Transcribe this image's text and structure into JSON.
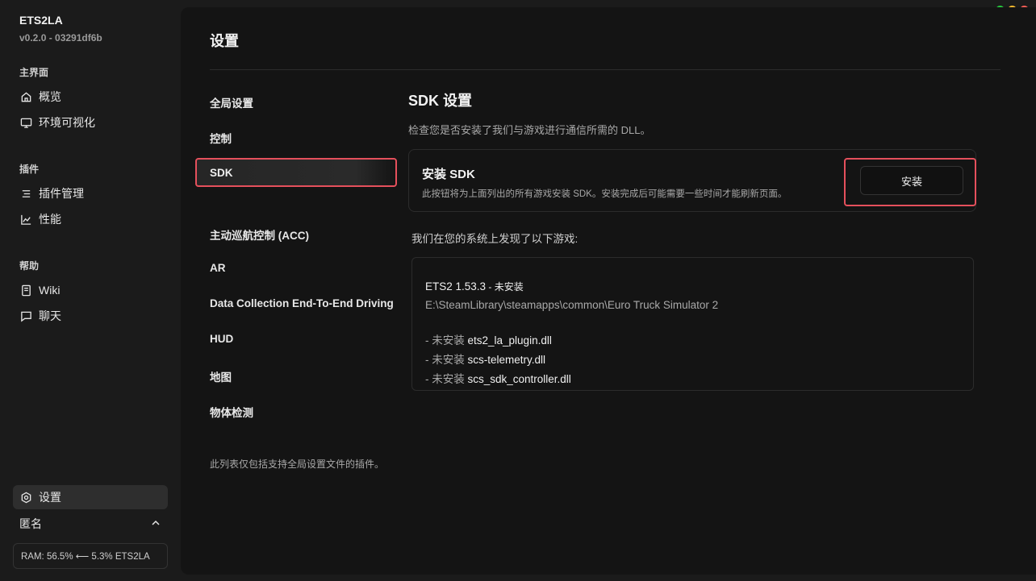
{
  "app": {
    "name": "ETS2LA",
    "version": "v0.2.0 - 03291df6b"
  },
  "sidebar": {
    "groups": [
      {
        "label": "主界面",
        "items": [
          {
            "label": "概览",
            "icon": "home-icon"
          },
          {
            "label": "环境可视化",
            "icon": "monitor-icon"
          }
        ]
      },
      {
        "label": "插件",
        "items": [
          {
            "label": "插件管理",
            "icon": "list-icon"
          },
          {
            "label": "性能",
            "icon": "chart-icon"
          }
        ]
      },
      {
        "label": "帮助",
        "items": [
          {
            "label": "Wiki",
            "icon": "book-icon"
          },
          {
            "label": "聊天",
            "icon": "chat-icon"
          }
        ]
      }
    ],
    "settings_label": "设置",
    "account_label": "匿名",
    "ram_status": "RAM: 56.5% ⟵ 5.3% ETS2LA"
  },
  "settings": {
    "title": "设置",
    "nav": [
      "全局设置",
      "控制",
      "SDK",
      "主动巡航控制 (ACC)",
      "AR",
      "Data Collection End-To-End Driving",
      "HUD",
      "地图",
      "物体检测"
    ],
    "footnote": "此列表仅包括支持全局设置文件的插件。"
  },
  "sdk": {
    "title": "SDK 设置",
    "description": "检查您是否安装了我们与游戏进行通信所需的 DLL。",
    "install_card": {
      "title": "安装 SDK",
      "description": "此按钮将为上面列出的所有游戏安装 SDK。安装完成后可能需要一些时间才能刷新页面。",
      "button_label": "安装"
    },
    "found_label": "我们在您的系统上发现了以下游戏:",
    "game": {
      "name": "ETS2 1.53.3",
      "status": " - 未安装",
      "path": "E:\\SteamLibrary\\steamapps\\common\\Euro Truck Simulator 2",
      "dlls": [
        {
          "prefix": "- 未安装 ",
          "file": "ets2_la_plugin.dll"
        },
        {
          "prefix": "- 未安装 ",
          "file": "scs-telemetry.dll"
        },
        {
          "prefix": "- 未安装 ",
          "file": "scs_sdk_controller.dll"
        }
      ]
    }
  },
  "colors": {
    "highlight": "#e5505c",
    "green": "#27c93f",
    "yellow": "#ffbd2e",
    "red": "#ff5f57"
  }
}
